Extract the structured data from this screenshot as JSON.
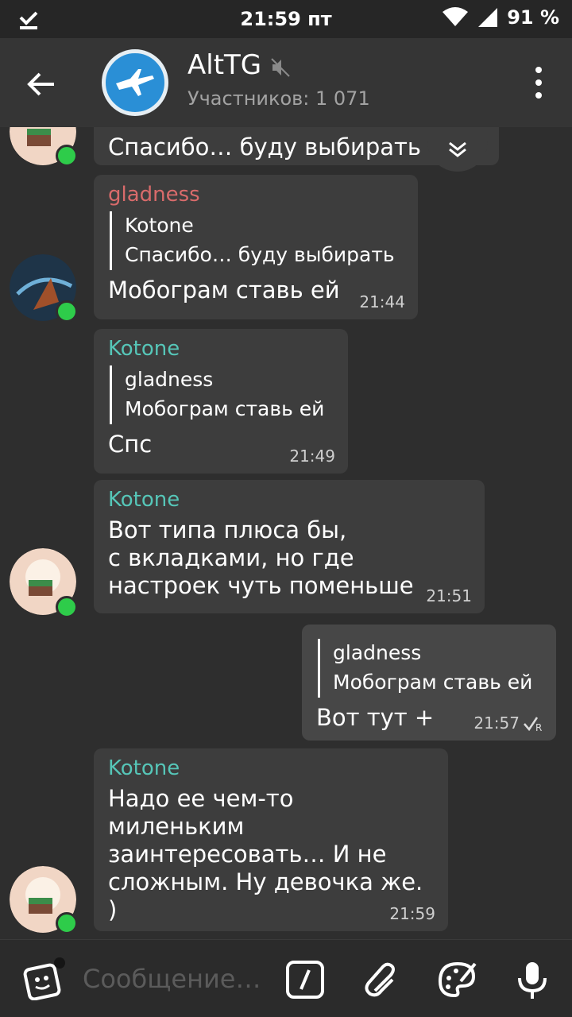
{
  "status_bar": {
    "time": "21:59 пт",
    "battery": "91 %"
  },
  "header": {
    "title": "AltTG",
    "subtitle": "Участников: 1 071"
  },
  "messages": [
    {
      "text": "Спасибо… буду выбирать"
    },
    {
      "sender": "gladness",
      "reply_name": "Kotone",
      "reply_text": "Спасибо… буду выбирать",
      "text": "Мобограм ставь ей",
      "time": "21:44"
    },
    {
      "sender": "Kotone",
      "reply_name": "gladness",
      "reply_text": "Мобограм ставь ей",
      "text": "Спс",
      "time": "21:49"
    },
    {
      "sender": "Kotone",
      "text_lines": [
        "Вот типа плюса бы,",
        "с вкладками, но где",
        "настроек чуть поменьше"
      ],
      "time": "21:51"
    },
    {
      "reply_name": "gladness",
      "reply_text": "Мобограм ставь ей",
      "text": "Вот тут +",
      "time": "21:57"
    },
    {
      "sender": "Kotone",
      "text_lines": [
        "Надо ее чем-то",
        "миленьким",
        "заинтересовать… И не",
        "сложным. Ну девочка же. )"
      ],
      "time": "21:59"
    }
  ],
  "input": {
    "placeholder": "Сообщение…"
  },
  "colors": {
    "background": "#2e2e2e",
    "bubble": "#3d3d3d",
    "online": "#2ecc4a",
    "sender_gladness": "#d96b6b",
    "sender_kotone": "#56c6b8"
  }
}
